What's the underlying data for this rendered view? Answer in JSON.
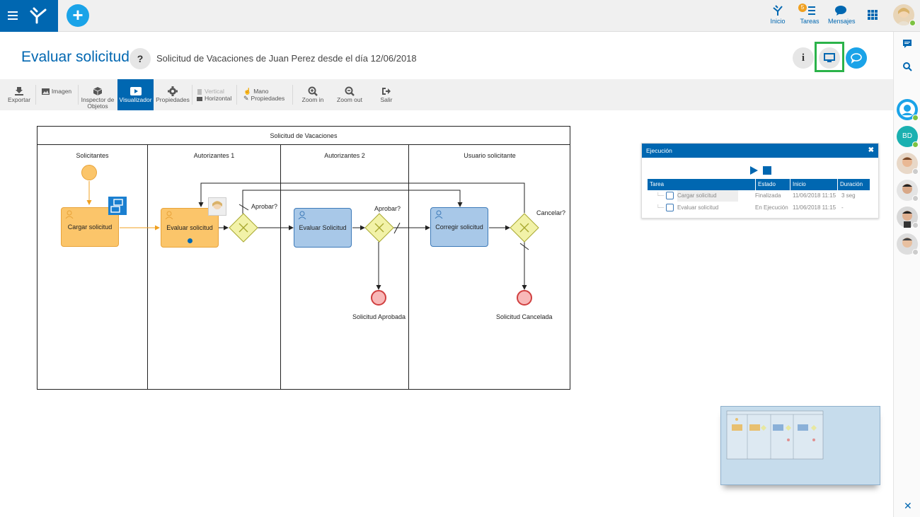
{
  "topbar": {
    "nav": [
      {
        "label": "Inicio",
        "icon": "home-icon"
      },
      {
        "label": "Tareas",
        "icon": "tasks-icon",
        "badge": "5"
      },
      {
        "label": "Mensajes",
        "icon": "messages-icon"
      }
    ],
    "rb_avatar_initials": "BD"
  },
  "header": {
    "title": "Evaluar solicitud",
    "help": "?",
    "subtitle": "Solicitud de Vacaciones de Juan  Perez desde el día 12/06/2018",
    "info_icon_label": "i"
  },
  "toolbar": {
    "exportar": "Exportar",
    "imagen": "Imagen",
    "inspector_l1": "Inspector de",
    "inspector_l2": "Objetos",
    "visualizador": "Visualizador",
    "propiedades": "Propiedades",
    "vertical": "Vertical",
    "horizontal": "Horizontal",
    "mano": "Mano",
    "propiedades2": "Propiedades",
    "zoom_in": "Zoom in",
    "zoom_out": "Zoom out",
    "salir": "Salir"
  },
  "diagram": {
    "pool_title": "Solicitud de Vacaciones",
    "lanes": [
      "Solicitantes",
      "Autorizantes 1",
      "Autorizantes 2",
      "Usuario solicitante"
    ],
    "tasks": {
      "cargar": "Cargar solicitud",
      "evaluar": "Evaluar solicitud",
      "evaluar2": "Evaluar Solicitud",
      "corregir": "Corregir solicitud"
    },
    "gateway_labels": {
      "g1": "Aprobar?",
      "g2": "Aprobar?",
      "g3": "Cancelar?"
    },
    "end_labels": {
      "aprobada": "Solicitud Aprobada",
      "cancelada": "Solicitud Cancelada"
    }
  },
  "execution_panel": {
    "title": "Ejecución",
    "columns": [
      "Tarea",
      "Estado",
      "Inicio",
      "Duración"
    ],
    "rows": [
      {
        "tarea": "Cargar solicitud",
        "estado": "Finalizada",
        "inicio": "11/06/2018 11:15",
        "duracion": "3 seg"
      },
      {
        "tarea": "Evaluar solicitud",
        "estado": "En Ejecución",
        "inicio": "11/06/2018 11:15",
        "duracion": "-"
      }
    ]
  },
  "colors": {
    "brand": "#0067b1",
    "accent": "#1aa3e8",
    "highlight": "#2bb34a"
  }
}
